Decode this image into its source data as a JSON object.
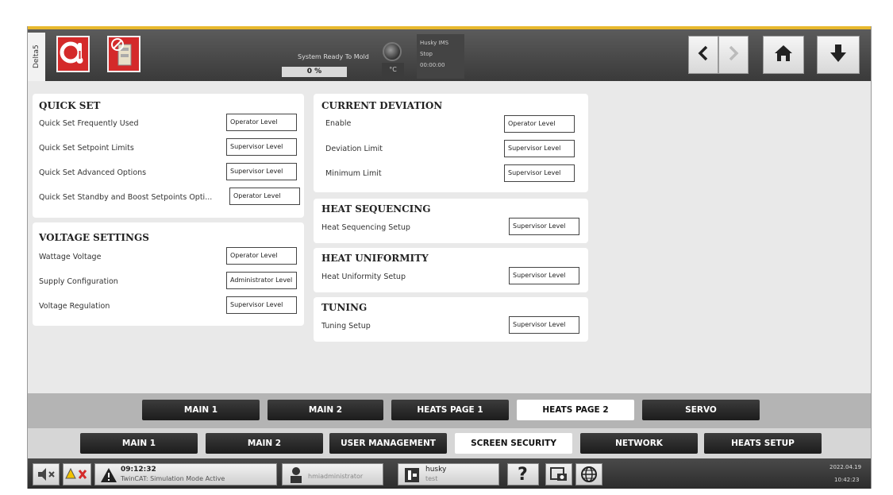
{
  "header": {
    "side_tab": "Delta5",
    "status_text": "System Ready To Mold",
    "progress": "0 %",
    "unit": "°C",
    "ims_title": "Husky IMS",
    "ims_state": "Stop",
    "ims_time": "00:00:00"
  },
  "quick_set": {
    "title": "QUICK SET",
    "rows": [
      {
        "label": "Quick Set Frequently Used",
        "value": "Operator Level"
      },
      {
        "label": "Quick Set Setpoint Limits",
        "value": "Supervisor Level"
      },
      {
        "label": "Quick Set Advanced Options",
        "value": "Supervisor Level"
      },
      {
        "label": "Quick Set Standby and Boost Setpoints Opti...",
        "value": "Operator Level"
      }
    ]
  },
  "voltage_settings": {
    "title": "VOLTAGE SETTINGS",
    "rows": [
      {
        "label": "Wattage Voltage",
        "value": "Operator Level"
      },
      {
        "label": "Supply Configuration",
        "value": "Administrator Level"
      },
      {
        "label": "Voltage Regulation",
        "value": "Supervisor Level"
      }
    ]
  },
  "current_deviation": {
    "title": "CURRENT DEVIATION",
    "rows": [
      {
        "label": "Enable",
        "value": "Operator Level"
      },
      {
        "label": "Deviation Limit",
        "value": "Supervisor Level"
      },
      {
        "label": "Minimum Limit",
        "value": "Supervisor Level"
      }
    ]
  },
  "heat_sequencing": {
    "title": "HEAT SEQUENCING",
    "label": "Heat Sequencing Setup",
    "value": "Supervisor Level"
  },
  "heat_uniformity": {
    "title": "HEAT UNIFORMITY",
    "label": "Heat Uniformity Setup",
    "value": "Supervisor Level"
  },
  "tuning": {
    "title": "TUNING",
    "label": "Tuning Setup",
    "value": "Supervisor Level"
  },
  "tabs_row1": [
    "MAIN 1",
    "MAIN 2",
    "HEATS PAGE 1",
    "HEATS PAGE 2",
    "SERVO"
  ],
  "tabs_row1_active": "HEATS PAGE 2",
  "tabs_row2": [
    "MAIN 1",
    "MAIN 2",
    "USER MANAGEMENT",
    "SCREEN SECURITY",
    "NETWORK",
    "HEATS SETUP"
  ],
  "tabs_row2_active": "SCREEN SECURITY",
  "statusbar": {
    "alarm_time": "09:12:32",
    "alarm_text": "TwinCAT: Simulation Mode Active",
    "user": "hmiadministrator",
    "machine_name": "husky",
    "machine_sub": "test",
    "date": "2022.04.19",
    "time": "10:42:23"
  },
  "colors": {
    "accent": "#e8b92e",
    "alarm_red": "#d42a2a",
    "tab_dark": "#1c1c1c"
  },
  "icons": [
    "thermometer-icon",
    "no-mold-icon",
    "chevron-left-icon",
    "chevron-right-icon",
    "home-icon",
    "download-arrow-icon",
    "mute-icon",
    "warning-icon",
    "user-icon",
    "machine-icon",
    "help-icon",
    "screenshot-icon",
    "globe-icon"
  ]
}
